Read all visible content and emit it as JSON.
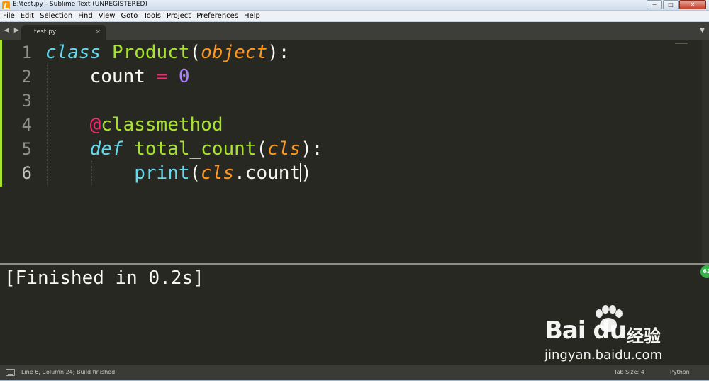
{
  "window": {
    "title": "E:\\test.py - Sublime Text (UNREGISTERED)",
    "minimize_glyph": "─",
    "maximize_glyph": "□",
    "close_glyph": "✕"
  },
  "menu": [
    "File",
    "Edit",
    "Selection",
    "Find",
    "View",
    "Goto",
    "Tools",
    "Project",
    "Preferences",
    "Help"
  ],
  "tabs": {
    "nav_glyph": "◀ ▶",
    "active": {
      "label": "test.py",
      "close_glyph": "×"
    },
    "menu_glyph": "▼"
  },
  "editor": {
    "current_line": 6,
    "line_numbers": [
      "1",
      "2",
      "3",
      "4",
      "5",
      "6"
    ],
    "code": {
      "l1": {
        "kw": "class",
        "name": "Product",
        "open": "(",
        "base": "object",
        "close": "):"
      },
      "l2": {
        "ident": "count",
        "op": "=",
        "num": "0"
      },
      "l4": {
        "at": "@",
        "deco": "classmethod"
      },
      "l5": {
        "kw": "def",
        "fn": "total_count",
        "open": "(",
        "param": "cls",
        "close": "):"
      },
      "l6": {
        "builtin": "print",
        "open": "(",
        "param": "cls",
        "rest": ".count",
        "close": ")"
      }
    }
  },
  "output": {
    "text": "[Finished in 0.2s]",
    "badge": "63"
  },
  "watermark": {
    "brand": "Bai du",
    "cn": "经验",
    "url": "jingyan.baidu.com"
  },
  "status": {
    "message": "Line 6, Column 24; Build finished",
    "tab_size": "Tab Size: 4",
    "syntax": "Python"
  },
  "colors": {
    "background": "#272822",
    "keyword": "#66d9ef",
    "class_name": "#a6e22e",
    "parameter": "#fd971f",
    "operator": "#f92672",
    "number": "#ae81ff"
  }
}
